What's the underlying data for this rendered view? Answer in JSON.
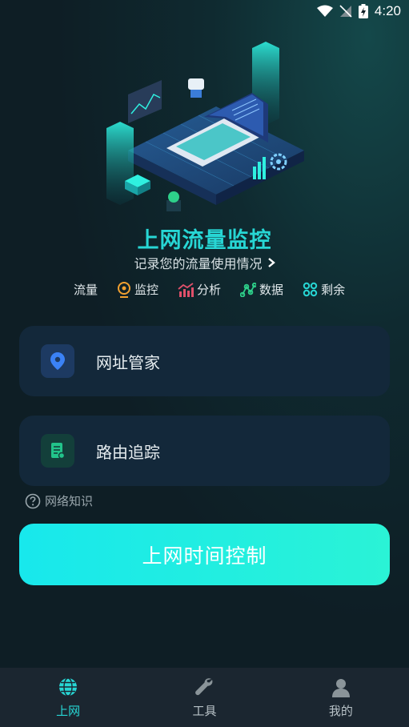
{
  "status_bar": {
    "time": "4:20"
  },
  "header": {
    "title": "上网流量监控",
    "subtitle": "记录您的流量使用情况"
  },
  "tags": [
    {
      "label": "流量",
      "icon": "none"
    },
    {
      "label": "监控",
      "icon": "webcam-icon",
      "color": "#f0a030"
    },
    {
      "label": "分析",
      "icon": "bar-chart-icon",
      "color": "#e0506a"
    },
    {
      "label": "数据",
      "icon": "nodes-icon",
      "color": "#2ed08a"
    },
    {
      "label": "剩余",
      "icon": "command-icon",
      "color": "#27d6d4"
    }
  ],
  "cards": [
    {
      "label": "网址管家",
      "icon": "location-pin-icon",
      "icon_bg": "#1d3a62",
      "icon_color": "#3b82f6"
    },
    {
      "label": "路由追踪",
      "icon": "document-icon",
      "icon_bg": "#133f3a",
      "icon_color": "#22c38a"
    }
  ],
  "help": {
    "label": "网络知识"
  },
  "primary_button": {
    "label": "上网时间控制"
  },
  "bottom_nav": [
    {
      "label": "上网",
      "icon": "globe-icon",
      "active": true
    },
    {
      "label": "工具",
      "icon": "wrench-icon",
      "active": false
    },
    {
      "label": "我的",
      "icon": "user-icon",
      "active": false
    }
  ],
  "colors": {
    "accent": "#27d6d4",
    "button_start": "#18e8ec",
    "button_end": "#2af3d6",
    "card_bg": "#13283a",
    "background": "#0e1e25"
  }
}
